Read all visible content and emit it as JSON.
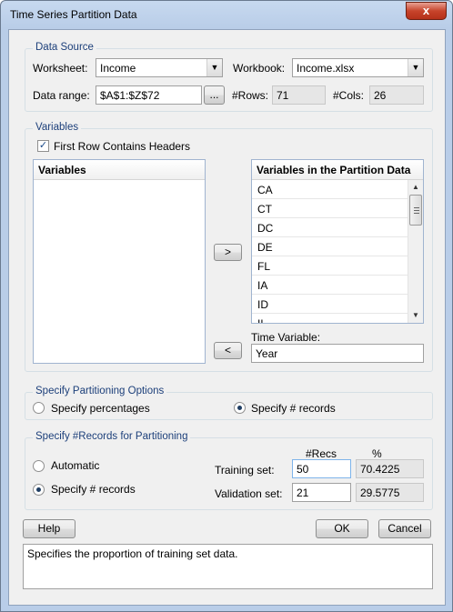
{
  "window": {
    "title": "Time Series Partition Data",
    "close_glyph": "x"
  },
  "data_source": {
    "legend": "Data Source",
    "worksheet_label": "Worksheet:",
    "worksheet_value": "Income",
    "workbook_label": "Workbook:",
    "workbook_value": "Income.xlsx",
    "range_label": "Data range:",
    "range_value": "$A$1:$Z$72",
    "browse_label": "...",
    "rows_label": "#Rows:",
    "rows_value": "71",
    "cols_label": "#Cols:",
    "cols_value": "26"
  },
  "variables": {
    "legend": "Variables",
    "headers_checkbox_label": "First Row Contains Headers",
    "headers_checked": true,
    "left_header": "Variables",
    "right_header": "Variables in the Partition Data",
    "right_items": [
      "CA",
      "CT",
      "DC",
      "DE",
      "FL",
      "IA",
      "ID",
      "IL"
    ],
    "move_right_label": ">",
    "move_left_label": "<",
    "time_variable_label": "Time Variable:",
    "time_variable_value": "Year"
  },
  "partition_options": {
    "legend": "Specify Partitioning Options",
    "percentages_label": "Specify percentages",
    "records_label": "Specify # records",
    "selected": "records"
  },
  "records": {
    "legend": "Specify #Records for Partitioning",
    "automatic_label": "Automatic",
    "specify_label": "Specify # records",
    "selected": "specify",
    "col_recs": "#Recs",
    "col_pct": "%",
    "training_label": "Training set:",
    "training_recs": "50",
    "training_pct": "70.4225",
    "validation_label": "Validation set:",
    "validation_recs": "21",
    "validation_pct": "29.5775"
  },
  "buttons": {
    "help": "Help",
    "ok": "OK",
    "cancel": "Cancel"
  },
  "status": {
    "text": "Specifies the proportion of training set data."
  }
}
